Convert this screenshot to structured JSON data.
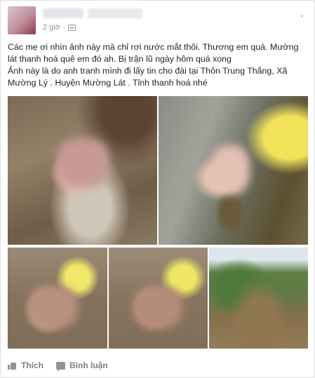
{
  "post": {
    "timestamp": "2 giờ",
    "separator": "·",
    "menu_icon": "chevron-down-icon",
    "privacy_icon": "globe-icon",
    "text_line1": "Các mẹ ơi nhìn ảnh này mà chỉ rơi nước mắt thôi. Thương em quá. Mường lát thanh hoá quê em đó ah. Bị trận lũ ngày hôm quá xong",
    "text_line2": "Ảnh này là do anh tranh mình đi lấy tin cho đài tại Thôn Trung Thắng, Xã Mường Lý . Huyện Mường Lát . Tỉnh thanh hoá nhé"
  },
  "actions": {
    "like_label": "Thích",
    "comment_label": "Bình luận"
  },
  "colors": {
    "background": "#e9ebee",
    "card": "#ffffff",
    "text": "#1d2129",
    "meta": "#90949c"
  }
}
